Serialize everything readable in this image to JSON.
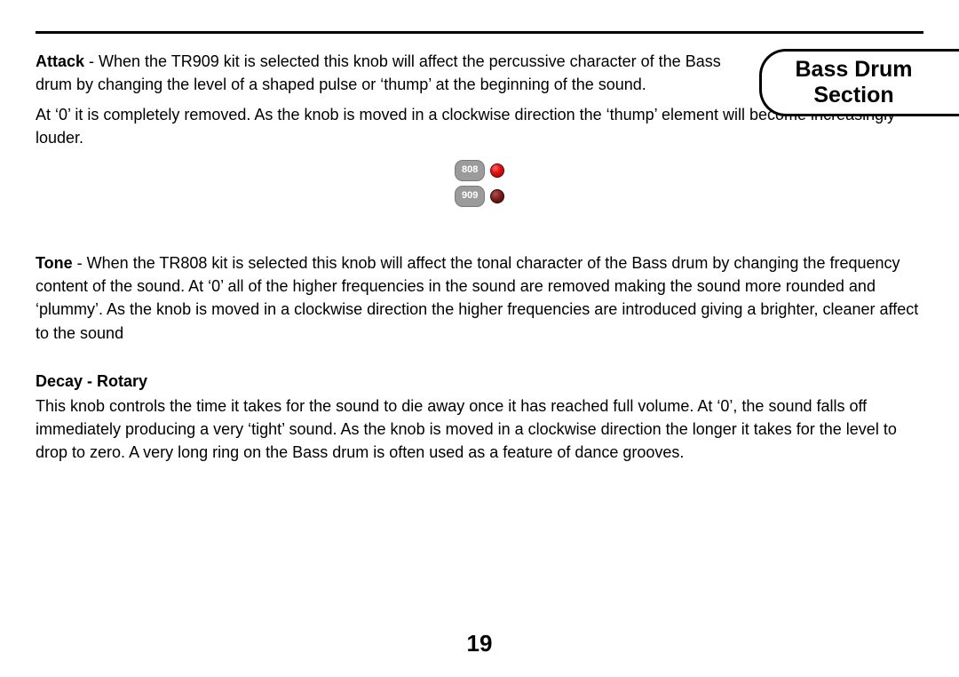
{
  "header": {
    "line1": "Bass Drum",
    "line2": "Section"
  },
  "attack": {
    "label": "Attack",
    "text_part1": " - When the TR909 kit is selected this knob will affect the percussive character of the Bass drum by changing the level of a shaped pulse or ‘thump’ at the beginning of the sound.",
    "text_part2": "At ‘0’ it is completely removed. As the knob is moved in a clockwise direction the ‘thump’ element will become increasingly louder."
  },
  "figure": {
    "row1": {
      "label": "808",
      "led_state": "on"
    },
    "row2": {
      "label": "909",
      "led_state": "off"
    }
  },
  "tone": {
    "label": "Tone",
    "text": " - When the TR808 kit is selected this knob will affect the tonal character of the Bass drum by changing the frequency content of the sound. At ‘0’ all of the higher frequencies in the sound are removed making the sound more rounded and ‘plummy’.  As the knob is moved in a clockwise direction the higher frequencies are introduced giving a brighter, cleaner affect to the sound"
  },
  "decay": {
    "heading": "Decay - Rotary",
    "text": "This knob controls the time it takes for the sound to die away once it has reached full volume. At ‘0’, the sound falls off immediately producing a very ‘tight’ sound. As the knob is moved in a clockwise direction the longer it takes for the level to drop to zero. A very long ring on the Bass drum is often used as a feature of dance grooves."
  },
  "page_number": "19"
}
